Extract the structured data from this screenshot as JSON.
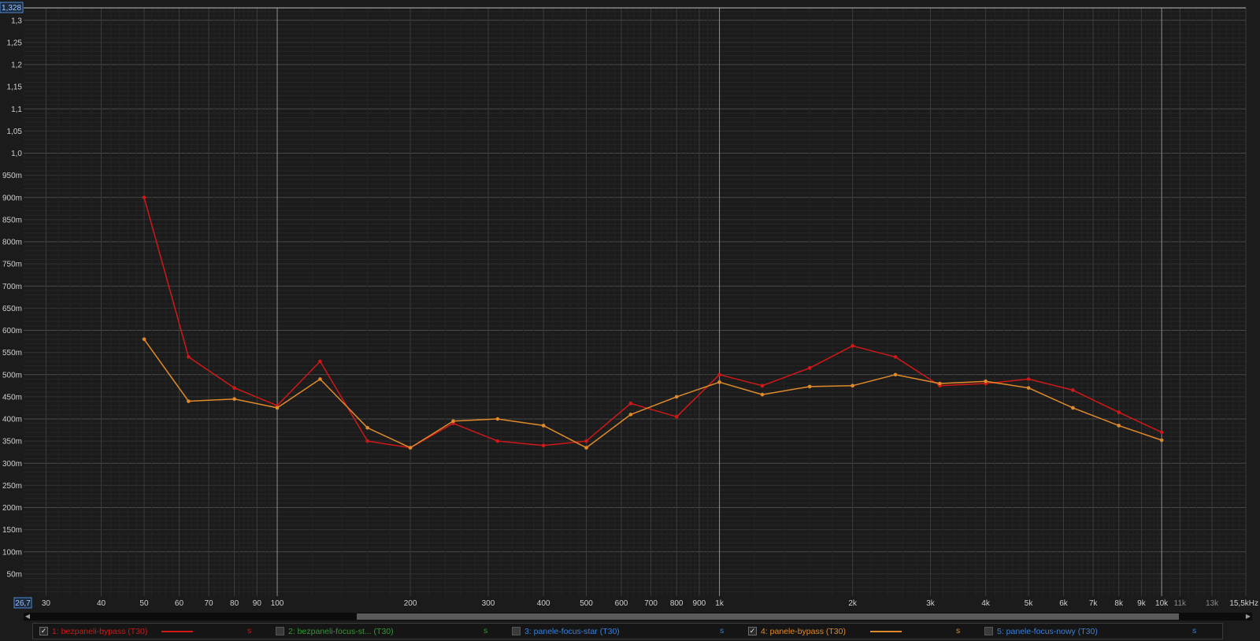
{
  "chart_data": {
    "type": "line",
    "x_scale": "log",
    "x_unit": "kHz",
    "xlim": [
      26.7,
      15500
    ],
    "ylim": [
      0,
      1.328
    ],
    "range_labels": {
      "y_max": "1,328",
      "x_min": "26,7"
    },
    "x_tick_labels": [
      {
        "v": 30,
        "t": "30"
      },
      {
        "v": 40,
        "t": "40"
      },
      {
        "v": 50,
        "t": "50"
      },
      {
        "v": 60,
        "t": "60"
      },
      {
        "v": 70,
        "t": "70"
      },
      {
        "v": 80,
        "t": "80"
      },
      {
        "v": 90,
        "t": "90"
      },
      {
        "v": 100,
        "t": "100"
      },
      {
        "v": 200,
        "t": "200"
      },
      {
        "v": 300,
        "t": "300"
      },
      {
        "v": 400,
        "t": "400"
      },
      {
        "v": 500,
        "t": "500"
      },
      {
        "v": 600,
        "t": "600"
      },
      {
        "v": 700,
        "t": "700"
      },
      {
        "v": 800,
        "t": "800"
      },
      {
        "v": 900,
        "t": "900"
      },
      {
        "v": 1000,
        "t": "1k"
      },
      {
        "v": 2000,
        "t": "2k"
      },
      {
        "v": 3000,
        "t": "3k"
      },
      {
        "v": 4000,
        "t": "4k"
      },
      {
        "v": 5000,
        "t": "5k"
      },
      {
        "v": 6000,
        "t": "6k"
      },
      {
        "v": 7000,
        "t": "7k"
      },
      {
        "v": 8000,
        "t": "8k"
      },
      {
        "v": 9000,
        "t": "9k"
      },
      {
        "v": 10000,
        "t": "10k"
      },
      {
        "v": 11000,
        "t": "11k",
        "minor": true
      },
      {
        "v": 13000,
        "t": "13k",
        "minor": true
      },
      {
        "v": 15500,
        "t": "15,5kHz"
      }
    ],
    "y_tick_labels": [
      {
        "v": 0.05,
        "t": "50m"
      },
      {
        "v": 0.1,
        "t": "100m"
      },
      {
        "v": 0.15,
        "t": "150m"
      },
      {
        "v": 0.2,
        "t": "200m"
      },
      {
        "v": 0.25,
        "t": "250m"
      },
      {
        "v": 0.3,
        "t": "300m"
      },
      {
        "v": 0.35,
        "t": "350m"
      },
      {
        "v": 0.4,
        "t": "400m"
      },
      {
        "v": 0.45,
        "t": "450m"
      },
      {
        "v": 0.5,
        "t": "500m"
      },
      {
        "v": 0.55,
        "t": "550m"
      },
      {
        "v": 0.6,
        "t": "600m"
      },
      {
        "v": 0.65,
        "t": "650m"
      },
      {
        "v": 0.7,
        "t": "700m"
      },
      {
        "v": 0.75,
        "t": "750m"
      },
      {
        "v": 0.8,
        "t": "800m"
      },
      {
        "v": 0.85,
        "t": "850m"
      },
      {
        "v": 0.9,
        "t": "900m"
      },
      {
        "v": 0.95,
        "t": "950m"
      },
      {
        "v": 1.0,
        "t": "1,0"
      },
      {
        "v": 1.05,
        "t": "1,05"
      },
      {
        "v": 1.1,
        "t": "1,1"
      },
      {
        "v": 1.15,
        "t": "1,15"
      },
      {
        "v": 1.2,
        "t": "1,2"
      },
      {
        "v": 1.25,
        "t": "1,25"
      },
      {
        "v": 1.3,
        "t": "1,3"
      }
    ],
    "x": [
      50,
      63,
      80,
      100,
      125,
      160,
      200,
      250,
      315,
      400,
      500,
      630,
      800,
      1000,
      1250,
      1600,
      2000,
      2500,
      3150,
      4000,
      5000,
      6300,
      8000,
      10000
    ],
    "series": [
      {
        "name": "1: bezpaneli-bypass (T30)",
        "color": "#d01818",
        "visible": true,
        "values": [
          0.9,
          0.54,
          0.47,
          0.43,
          0.53,
          0.35,
          0.335,
          0.39,
          0.35,
          0.34,
          0.35,
          0.435,
          0.405,
          0.5,
          0.475,
          0.515,
          0.565,
          0.54,
          0.475,
          0.48,
          0.49,
          0.465,
          0.415,
          0.37
        ]
      },
      {
        "name": "2: bezpaneli-focus-st... (T30)",
        "color": "#2e9a2e",
        "visible": false,
        "values": []
      },
      {
        "name": "3: panele-focus-star (T30)",
        "color": "#3c7fd8",
        "visible": false,
        "values": []
      },
      {
        "name": "4: panele-bypass (T30)",
        "color": "#e08a2a",
        "visible": true,
        "values": [
          0.58,
          0.44,
          0.445,
          0.425,
          0.49,
          0.38,
          0.335,
          0.395,
          0.4,
          0.385,
          0.335,
          0.41,
          0.45,
          0.483,
          0.455,
          0.473,
          0.475,
          0.5,
          0.48,
          0.485,
          0.47,
          0.425,
          0.385,
          0.352
        ]
      },
      {
        "name": "5: panele-focus-nowy (T30)",
        "color": "#3c7fd8",
        "visible": false,
        "values": []
      }
    ],
    "grid": true
  },
  "legend": {
    "unit": "s",
    "check_mark": "✓",
    "items": [
      {
        "label": "1: bezpaneli-bypass (T30)",
        "checked": true,
        "color": "#d01818"
      },
      {
        "label": "2: bezpaneli-focus-st... (T30)",
        "checked": false,
        "color": "#2e9a2e"
      },
      {
        "label": "3: panele-focus-star (T30)",
        "checked": false,
        "color": "#3c7fd8"
      },
      {
        "label": "4: panele-bypass (T30)",
        "checked": true,
        "color": "#e08a2a"
      },
      {
        "label": "5: panele-focus-nowy (T30)",
        "checked": false,
        "color": "#3c7fd8"
      }
    ]
  },
  "scrollbar": {
    "left_arrow": "◀",
    "right_arrow": "▶"
  }
}
